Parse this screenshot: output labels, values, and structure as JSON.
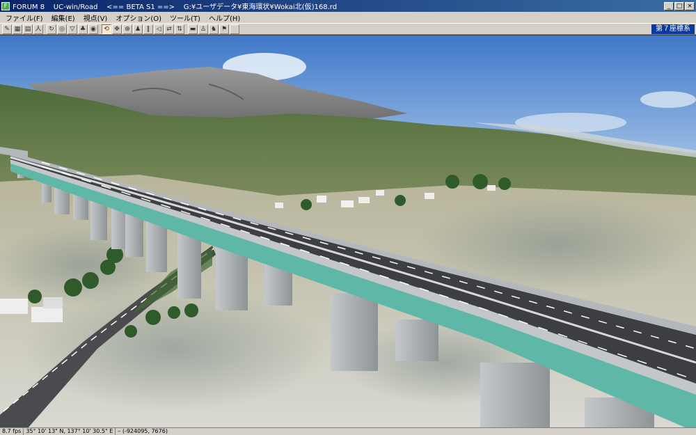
{
  "window": {
    "app_name": "FORUM 8",
    "product": "UC-win/Road",
    "version": "<== BETA S1 ==>",
    "file_path": "G:¥ユーザデータ¥東海環状¥Wokai北(仮)168.rd",
    "controls": {
      "minimize": "_",
      "maximize": "□",
      "close": "×"
    }
  },
  "menu": {
    "items": [
      "ファイル(F)",
      "編集(E)",
      "視点(V)",
      "オプション(O)",
      "ツール(T)",
      "ヘルプ(H)"
    ]
  },
  "toolbar": {
    "viewpoint_label": "第７座標系",
    "buttons": [
      {
        "name": "pen-icon",
        "glyph": "✎"
      },
      {
        "name": "grid-icon",
        "glyph": "▦"
      },
      {
        "name": "table-icon",
        "glyph": "▤"
      },
      {
        "name": "person-icon",
        "glyph": "人"
      },
      {
        "name": "refresh-icon",
        "glyph": "↻"
      },
      {
        "name": "eye-icon",
        "glyph": "◎"
      },
      {
        "name": "sign-icon",
        "glyph": "▽"
      },
      {
        "name": "tree-icon",
        "glyph": "♣"
      },
      {
        "name": "camera-icon",
        "glyph": "◉"
      },
      {
        "name": "rotate-icon",
        "glyph": "⟲"
      },
      {
        "name": "move-icon",
        "glyph": "✥"
      },
      {
        "name": "zoom-icon",
        "glyph": "⊕"
      },
      {
        "name": "walk-icon",
        "glyph": "♟"
      },
      {
        "name": "pause-icon",
        "glyph": "‖"
      },
      {
        "name": "slow-icon",
        "glyph": "◁"
      },
      {
        "name": "swap-icon",
        "glyph": "⇄"
      },
      {
        "name": "flip-icon",
        "glyph": "⇅"
      },
      {
        "name": "car-icon",
        "glyph": "▬"
      },
      {
        "name": "pedestrian-icon",
        "glyph": "♙"
      },
      {
        "name": "bicycle-icon",
        "glyph": "♞"
      },
      {
        "name": "runner-icon",
        "glyph": "⚑"
      },
      {
        "name": "blank-icon",
        "glyph": ""
      }
    ]
  },
  "status": {
    "fps": "8.7 fps",
    "coordinates": "35° 10' 13\" N, 137° 10' 30.5\" E",
    "position": "– (-924095, 7676)"
  },
  "colors": {
    "title_start": "#0a246a",
    "title_end": "#3a6ea5",
    "sky_top": "#3f78c8",
    "sky_bottom": "#a9c7e8",
    "road_surface": "#3d3e42",
    "parapet": "#b4b8bc",
    "girder": "#5fb7a8"
  }
}
